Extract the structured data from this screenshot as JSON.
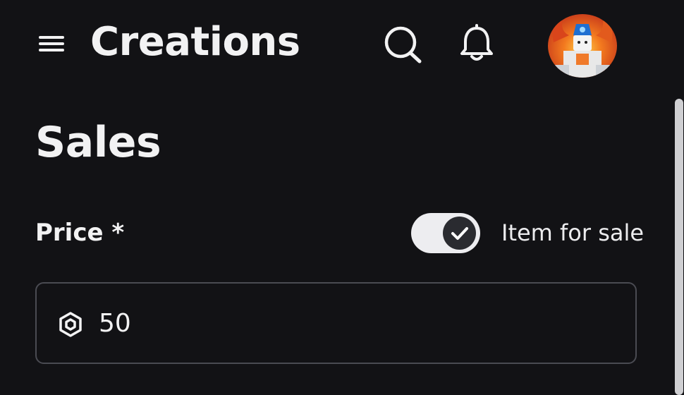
{
  "header": {
    "title": "Creations",
    "icons": {
      "menu": "hamburger-menu-icon",
      "search": "search-icon",
      "notifications": "bell-icon",
      "avatar": "user-avatar"
    }
  },
  "section": {
    "title": "Sales"
  },
  "price": {
    "label": "Price *",
    "value": "50",
    "currency_icon": "robux-icon"
  },
  "for_sale_toggle": {
    "label": "Item for sale",
    "checked": true
  },
  "colors": {
    "background": "#121215",
    "text": "#f2f2f3",
    "toggle_track": "#ededf0",
    "toggle_knob": "#2a2b30",
    "field_border": "#4a4b52"
  }
}
